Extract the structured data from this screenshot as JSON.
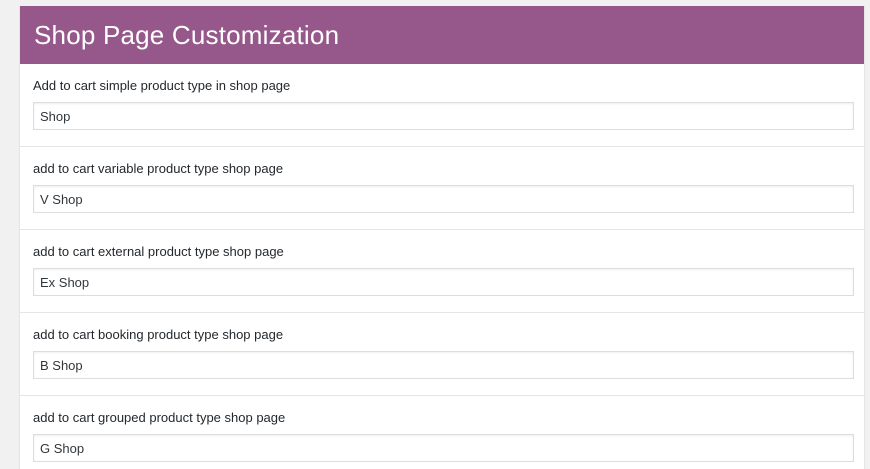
{
  "header": {
    "title": "Shop Page Customization"
  },
  "fields": [
    {
      "label": "Add to cart simple product type in shop page",
      "value": "Shop"
    },
    {
      "label": "add to cart variable product type shop page",
      "value": "V Shop"
    },
    {
      "label": "add to cart external product type shop page",
      "value": "Ex Shop"
    },
    {
      "label": "add to cart booking product type shop page",
      "value": "B Shop"
    },
    {
      "label": "add to cart grouped product type shop page",
      "value": "G Shop"
    }
  ],
  "colors": {
    "header_bg": "#96588a",
    "header_text": "#ffffff",
    "panel_bg": "#ffffff",
    "page_bg": "#f1f1f1"
  }
}
